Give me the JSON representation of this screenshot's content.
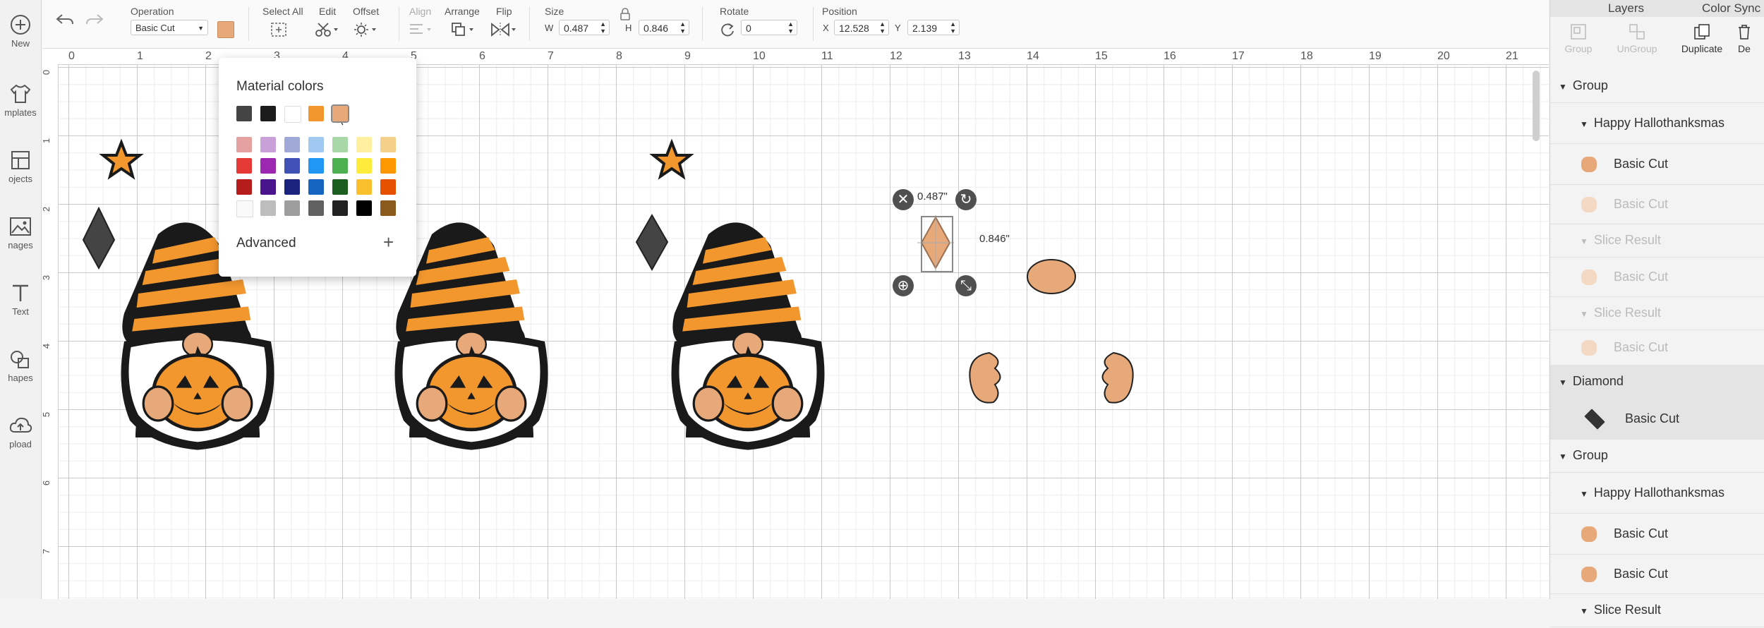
{
  "sidebar": {
    "items": [
      {
        "icon": "plus-circle-icon",
        "label": "New"
      },
      {
        "icon": "shirt-icon",
        "label": "mplates"
      },
      {
        "icon": "projects-icon",
        "label": "ojects"
      },
      {
        "icon": "image-icon",
        "label": "nages"
      },
      {
        "icon": "text-icon",
        "label": "Text"
      },
      {
        "icon": "shapes-icon",
        "label": "hapes"
      },
      {
        "icon": "upload-cloud-icon",
        "label": "pload"
      }
    ]
  },
  "toolbar": {
    "operation_title": "Operation",
    "operation_value": "Basic Cut",
    "operation_color": "#e8a97a",
    "select_all_title": "Select All",
    "edit_title": "Edit",
    "offset_title": "Offset",
    "align_title": "Align",
    "arrange_title": "Arrange",
    "flip_title": "Flip",
    "size_title": "Size",
    "w_label": "W",
    "w_value": "0.487",
    "h_label": "H",
    "h_value": "0.846",
    "rotate_title": "Rotate",
    "rotate_value": "0",
    "position_title": "Position",
    "x_label": "X",
    "x_value": "12.528",
    "y_label": "Y",
    "y_value": "2.139"
  },
  "ruler": {
    "top": [
      "0",
      "1",
      "2",
      "3",
      "4",
      "5",
      "6",
      "7",
      "8",
      "9",
      "10",
      "11",
      "12",
      "13",
      "14",
      "15",
      "16",
      "17",
      "18",
      "19",
      "20",
      "21"
    ],
    "left": [
      "0",
      "1",
      "2",
      "3",
      "4",
      "5",
      "6",
      "7"
    ]
  },
  "popover": {
    "title": "Material colors",
    "advanced_label": "Advanced",
    "plus": "+",
    "top_row": [
      "#444444",
      "#1c1c1c",
      "#ffffff",
      "#f2962e",
      "#e8a97a"
    ],
    "grid": [
      [
        "#e5a0a0",
        "#c9a0d8",
        "#a0a8d8",
        "#a0c8f0",
        "#a8d8a8",
        "#fff0a0",
        "#f5d08a"
      ],
      [
        "#e53935",
        "#9c27b0",
        "#3f51b5",
        "#2196f3",
        "#4caf50",
        "#ffeb3b",
        "#ff9800"
      ],
      [
        "#b71c1c",
        "#4a148c",
        "#1a237e",
        "#1565c0",
        "#1b5e20",
        "#fbc02d",
        "#e65100"
      ],
      [
        "#fafafa",
        "#bdbdbd",
        "#9e9e9e",
        "#616161",
        "#212121",
        "#000000",
        "#8d5a1e"
      ]
    ]
  },
  "selection": {
    "width_label": "0.487\"",
    "height_label": "0.846\""
  },
  "panel": {
    "tab_layers": "Layers",
    "tab_color_sync": "Color Sync",
    "tools": [
      "Group",
      "UnGroup",
      "Duplicate",
      "De"
    ],
    "layers": [
      {
        "label": "Group",
        "level": 0,
        "arrow": "▼",
        "style": "normal"
      },
      {
        "label": "Happy Hallothanksmas",
        "level": 1,
        "arrow": "▼",
        "style": "normal"
      },
      {
        "label": "Basic Cut",
        "level": 2,
        "arrow": "",
        "style": "normal"
      },
      {
        "label": "Basic Cut",
        "level": 2,
        "arrow": "",
        "style": "dim"
      },
      {
        "label": "Slice Result",
        "level": 1,
        "arrow": "▼",
        "style": "dim"
      },
      {
        "label": "Basic Cut",
        "level": 2,
        "arrow": "",
        "style": "dim"
      },
      {
        "label": "Slice Result",
        "level": 1,
        "arrow": "▼",
        "style": "dim"
      },
      {
        "label": "Basic Cut",
        "level": 2,
        "arrow": "",
        "style": "dim"
      },
      {
        "label": "Diamond",
        "level": 0,
        "arrow": "▼",
        "style": "sel"
      },
      {
        "label": "Basic Cut",
        "level": 2,
        "arrow": "",
        "style": "sel"
      },
      {
        "label": "Group",
        "level": 0,
        "arrow": "▼",
        "style": "normal"
      },
      {
        "label": "Happy Hallothanksmas",
        "level": 1,
        "arrow": "▼",
        "style": "normal"
      },
      {
        "label": "Basic Cut",
        "level": 2,
        "arrow": "",
        "style": "normal"
      },
      {
        "label": "Basic Cut",
        "level": 2,
        "arrow": "",
        "style": "normal"
      },
      {
        "label": "Slice Result",
        "level": 1,
        "arrow": "▼",
        "style": "normal"
      }
    ]
  }
}
